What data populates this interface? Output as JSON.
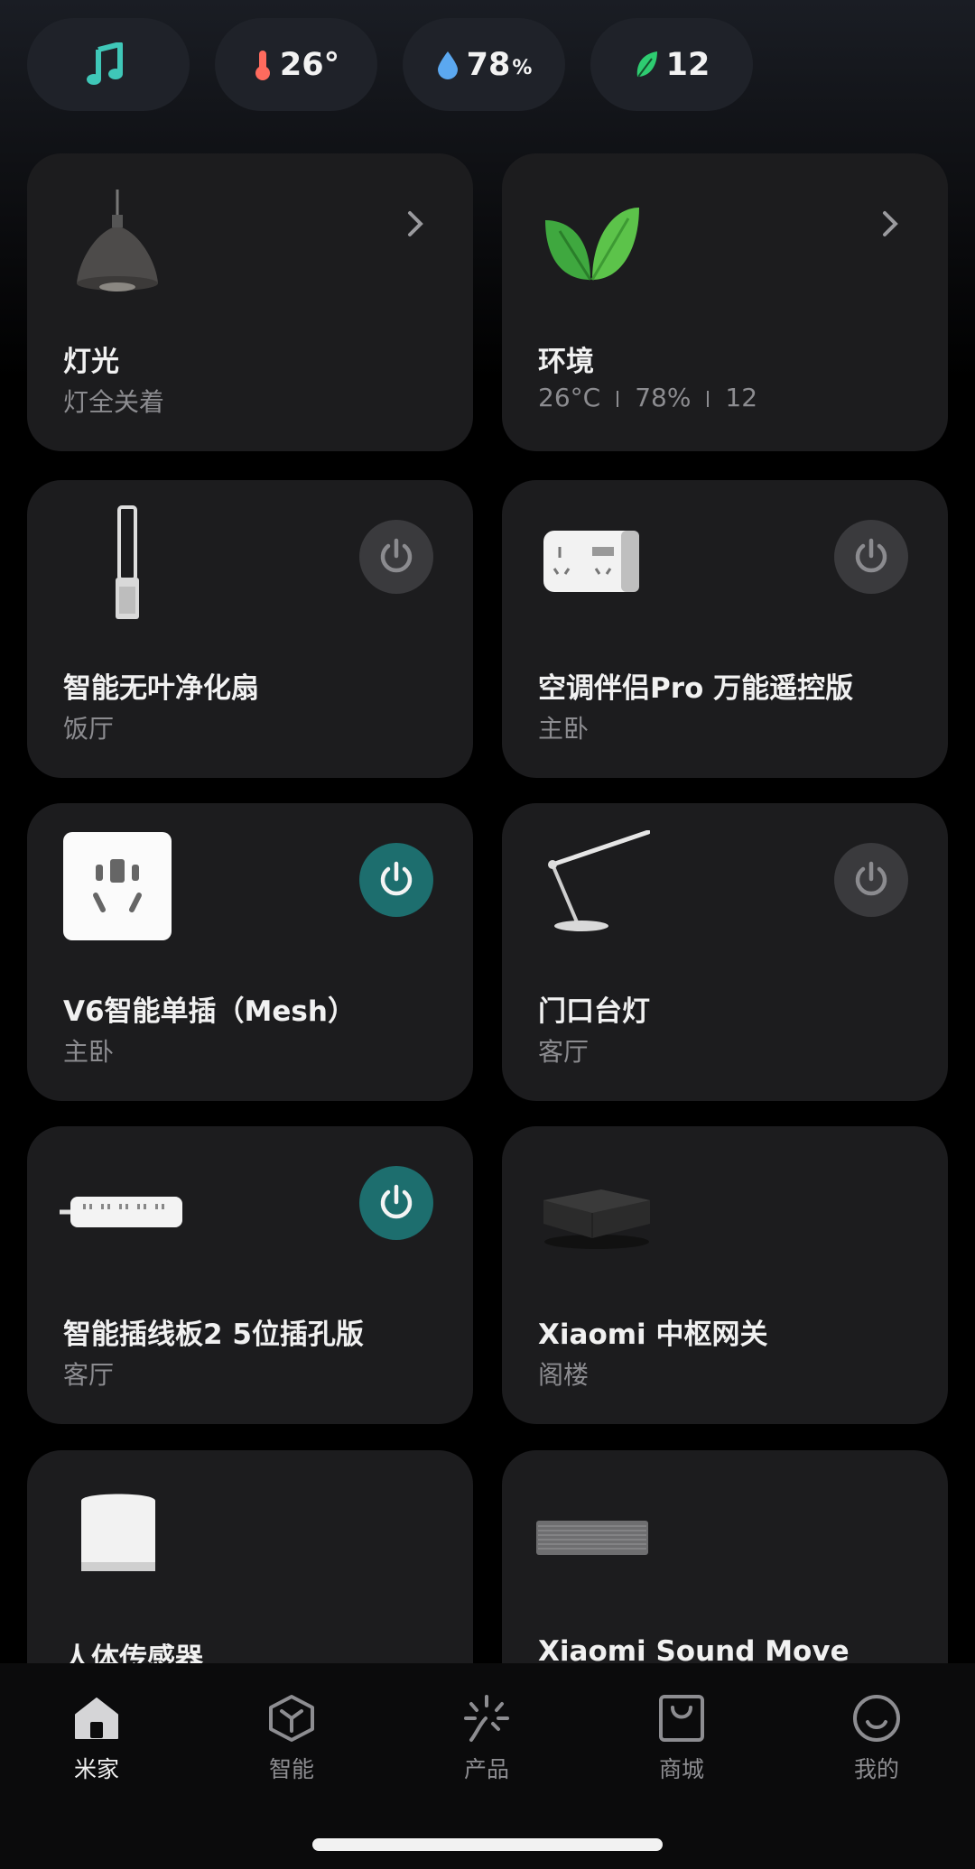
{
  "status_bar": {
    "temperature": "26°",
    "humidity": "78",
    "humidity_unit": "%",
    "air_quality": "12"
  },
  "cards": {
    "lighting": {
      "title": "灯光",
      "subtitle": "灯全关着"
    },
    "environment": {
      "title": "环境",
      "temp": "26°C",
      "humidity": "78%",
      "aqi": "12"
    },
    "purifier_fan": {
      "title": "智能无叶净化扇",
      "room": "饭厅",
      "power": "off"
    },
    "ac_companion": {
      "title": "空调伴侣Pro 万能遥控版",
      "room": "主卧",
      "power": "off"
    },
    "smart_plug": {
      "title": "V6智能单插（Mesh）",
      "room": "主卧",
      "power": "on"
    },
    "desk_lamp": {
      "title": "门口台灯",
      "room": "客厅",
      "power": "off"
    },
    "power_strip": {
      "title": "智能插线板2 5位插孔版",
      "room": "客厅",
      "power": "on"
    },
    "gateway": {
      "title": "Xiaomi 中枢网关",
      "room": "阁楼"
    },
    "motion_sensor": {
      "title": "人体传感器"
    },
    "speaker": {
      "title": "Xiaomi Sound Move"
    }
  },
  "tabbar": {
    "home": "米家",
    "smart": "智能",
    "products": "产品",
    "store": "商城",
    "profile": "我的"
  },
  "colors": {
    "accent_on": "#1d6e6e",
    "power_off_bg": "#3a3a3d",
    "card_bg": "#1c1c1e"
  }
}
